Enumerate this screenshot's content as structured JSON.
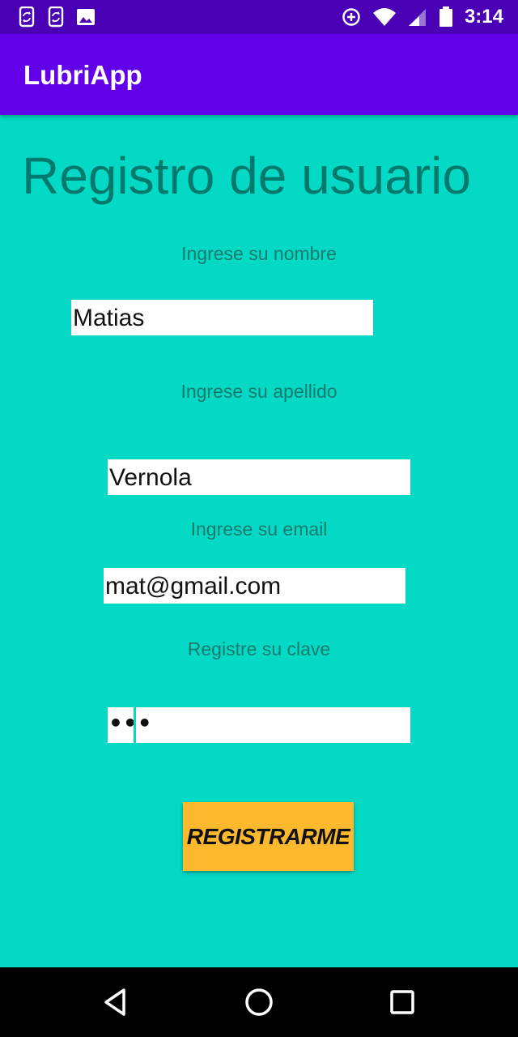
{
  "status_bar": {
    "time": "3:14",
    "left_icons": [
      "phone-sync-icon",
      "phone-sync-icon",
      "image-icon"
    ],
    "right_icons": [
      "data-saver-icon",
      "wifi-icon",
      "signal-icon",
      "battery-icon"
    ]
  },
  "app_bar": {
    "title": "LubriApp"
  },
  "page": {
    "title": "Registro de usuario"
  },
  "form": {
    "nombre": {
      "label": "Ingrese su nombre",
      "value": "Matias"
    },
    "apellido": {
      "label": "Ingrese su apellido",
      "value": "Vernola"
    },
    "email": {
      "label": "Ingrese su email",
      "value": "mat@gmail.com"
    },
    "clave": {
      "label": "Registre su clave",
      "masked": "•••"
    },
    "submit_label": "REGISTRARME"
  },
  "nav_bar": {
    "buttons": [
      "back-icon",
      "home-icon",
      "recents-icon"
    ]
  },
  "colors": {
    "status_bar": "#4a00b4",
    "app_bar": "#6200ea",
    "background": "#03d9c5",
    "title_text": "#017a6e",
    "button": "#fdb92e"
  }
}
